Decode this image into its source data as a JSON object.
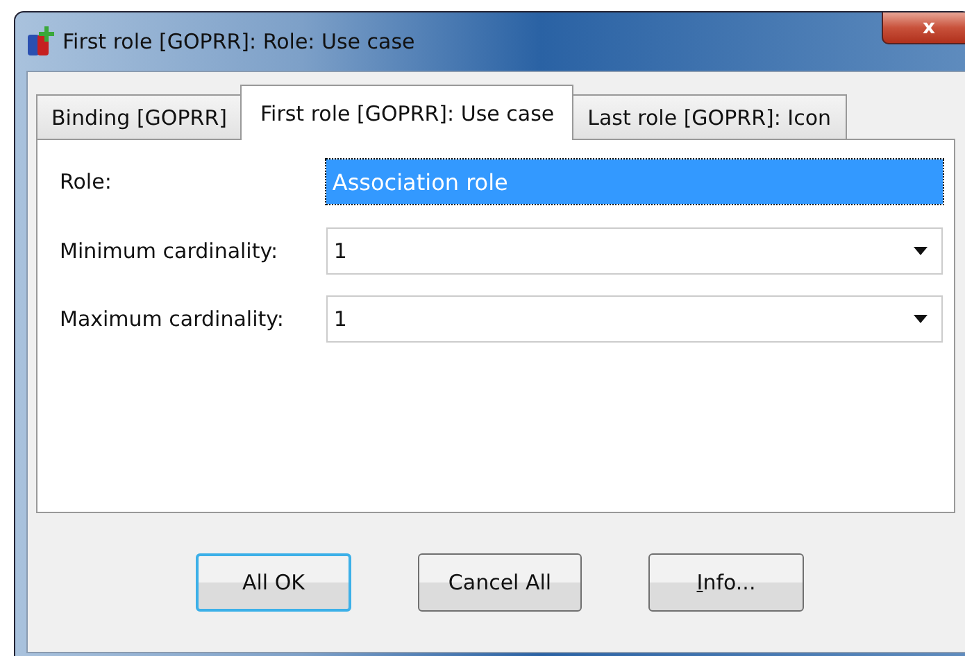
{
  "window": {
    "title": "First role [GOPRR]: Role: Use case",
    "close_label": "x"
  },
  "tabs": [
    {
      "label": "Binding [GOPRR]",
      "selected": false
    },
    {
      "label": "First role [GOPRR]: Use case",
      "selected": true
    },
    {
      "label": "Last role [GOPRR]: Icon",
      "selected": false
    }
  ],
  "fields": [
    {
      "label": "Role:",
      "kind": "text",
      "value": "Association role",
      "selected": true
    },
    {
      "label": "Minimum cardinality:",
      "kind": "dropdown",
      "value": "1",
      "selected": false
    },
    {
      "label": "Maximum cardinality:",
      "kind": "dropdown",
      "value": "1",
      "selected": false
    }
  ],
  "buttons": [
    {
      "label": "All OK",
      "default": true,
      "underline_first": false
    },
    {
      "label": "Cancel All",
      "default": false,
      "underline_first": false
    },
    {
      "label": "Info...",
      "default": false,
      "underline_first": true
    }
  ]
}
